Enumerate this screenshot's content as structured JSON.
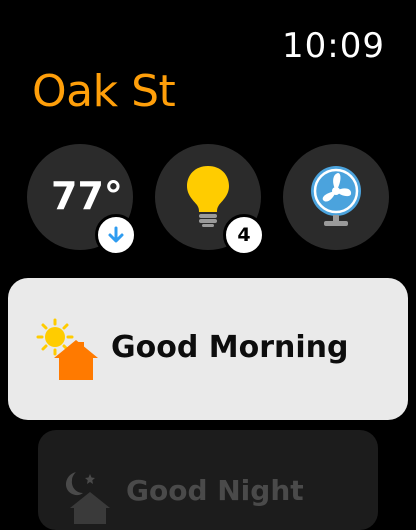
{
  "status": {
    "time": "10:09"
  },
  "home": {
    "title": "Oak St"
  },
  "accessories": {
    "thermostat": {
      "temperature": "77°",
      "mode_icon": "arrow-down-icon"
    },
    "lights": {
      "icon": "lightbulb-icon",
      "count": "4"
    },
    "fan": {
      "icon": "fan-icon"
    }
  },
  "scenes": [
    {
      "label": "Good Morning",
      "icon": "sun-house-icon"
    },
    {
      "label": "Good Night",
      "icon": "moon-house-icon"
    }
  ],
  "colors": {
    "accent": "#ff9f0a",
    "tile": "#2b2b2b",
    "card": "#eaeaea",
    "bulb": "#ffcc00",
    "fan": "#4ba3dd"
  }
}
